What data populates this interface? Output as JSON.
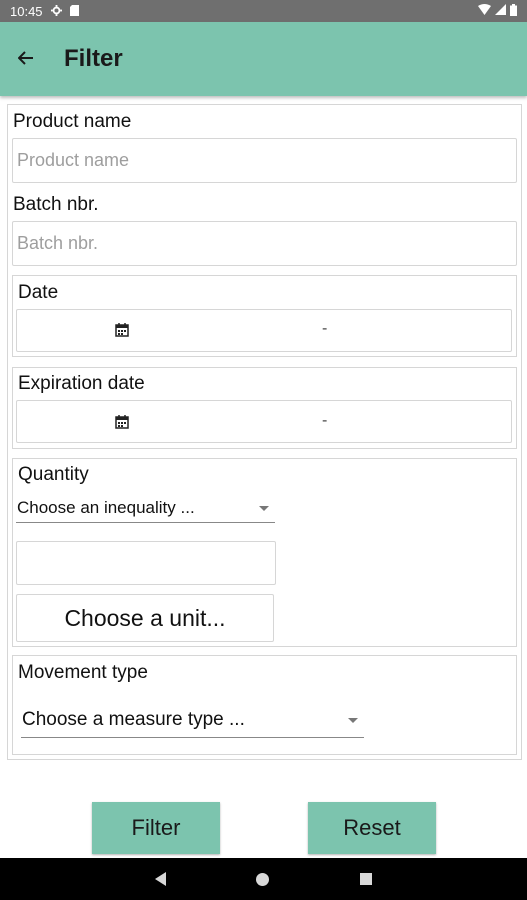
{
  "status_bar": {
    "time": "10:45",
    "icons": [
      "settings-icon",
      "sd-card-icon",
      "wifi-icon",
      "signal-icon",
      "battery-icon"
    ]
  },
  "app_bar": {
    "title": "Filter",
    "back_icon": "arrow-back-icon",
    "color": "#7cc4ae"
  },
  "form": {
    "product_name": {
      "label": "Product name",
      "placeholder": "Product name",
      "value": ""
    },
    "batch": {
      "label": "Batch nbr.",
      "placeholder": "Batch nbr.",
      "value": ""
    },
    "date": {
      "label": "Date",
      "separator": "-"
    },
    "expiration_date": {
      "label": "Expiration date",
      "separator": "-"
    },
    "quantity": {
      "label": "Quantity",
      "inequality_selected": "Choose an inequality ...",
      "value": "",
      "unit_button": "Choose a unit..."
    },
    "movement_type": {
      "label": "Movement type",
      "measure_selected": "Choose a measure type ..."
    }
  },
  "actions": {
    "filter": "Filter",
    "reset": "Reset"
  },
  "nav_bar": {
    "icons": [
      "nav-back-icon",
      "nav-home-icon",
      "nav-recents-icon"
    ]
  }
}
